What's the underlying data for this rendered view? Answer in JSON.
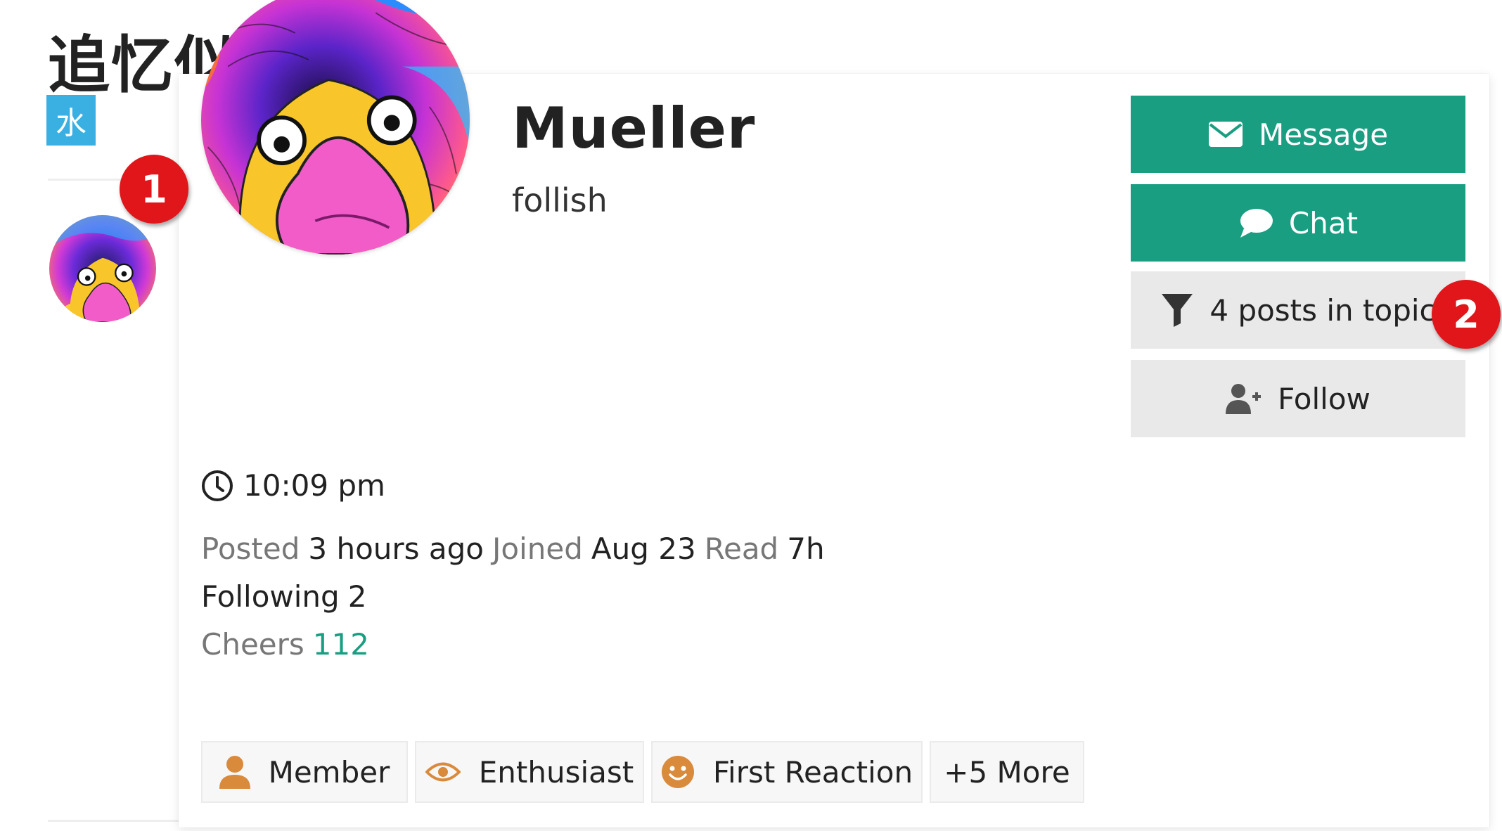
{
  "background": {
    "topic_title": "追忆似",
    "category_label": "水"
  },
  "user_card": {
    "name": "Mueller",
    "title": "follish",
    "local_time": "10:09 pm",
    "buttons": {
      "message": "Message",
      "chat": "Chat",
      "filter": "4 posts in topic",
      "follow": "Follow"
    },
    "meta": {
      "posted_label": "Posted",
      "posted_value": "3 hours ago",
      "joined_label": "Joined",
      "joined_value": "Aug 23",
      "read_label": "Read",
      "read_value": "7h",
      "following_label": "Following",
      "following_value": "2",
      "cheers_label": "Cheers",
      "cheers_value": "112"
    },
    "badges": [
      {
        "label": "Member",
        "icon": "user-icon"
      },
      {
        "label": "Enthusiast",
        "icon": "eye-icon"
      },
      {
        "label": "First Reaction",
        "icon": "smile-icon"
      },
      {
        "label": "+5 More",
        "icon": ""
      }
    ]
  },
  "markers": [
    "1",
    "2"
  ],
  "colors": {
    "primary_button": "#1a9e81",
    "secondary_button": "#e9e9e9",
    "category": "#3ab0e2",
    "marker": "#e0161b",
    "badge_icon": "#d98a3a"
  }
}
